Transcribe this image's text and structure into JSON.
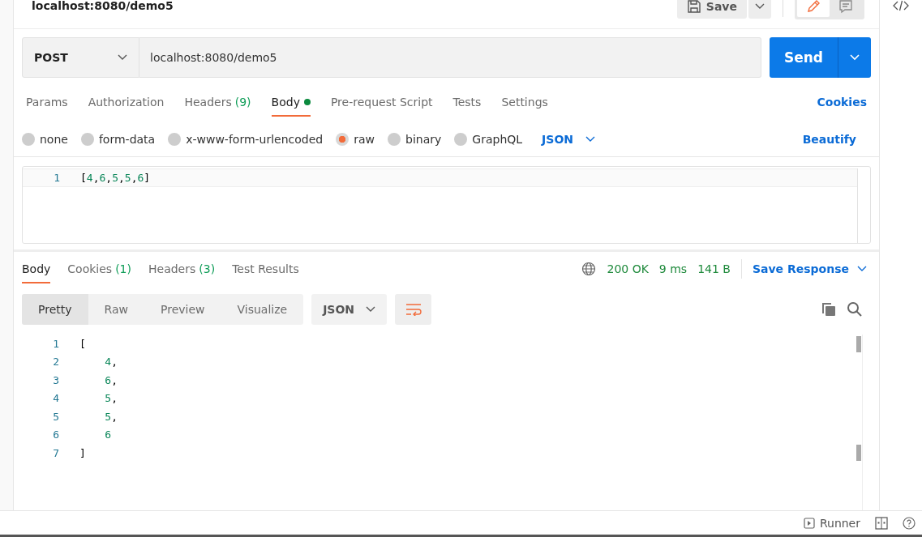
{
  "request_title": "localhost:8080/demo5",
  "header_actions": {
    "save": "Save"
  },
  "url_bar": {
    "method": "POST",
    "url": "localhost:8080/demo5",
    "send": "Send"
  },
  "request_tabs": [
    {
      "label": "Params",
      "selected": false
    },
    {
      "label": "Authorization",
      "selected": false
    },
    {
      "label": "Headers",
      "count": "(9)",
      "selected": false
    },
    {
      "label": "Body",
      "selected": true,
      "indicator": true
    },
    {
      "label": "Pre-request Script",
      "selected": false
    },
    {
      "label": "Tests",
      "selected": false
    },
    {
      "label": "Settings",
      "selected": false
    }
  ],
  "cookies_link": "Cookies",
  "body_types": [
    {
      "label": "none",
      "selected": false
    },
    {
      "label": "form-data",
      "selected": false
    },
    {
      "label": "x-www-form-urlencoded",
      "selected": false
    },
    {
      "label": "raw",
      "selected": true
    },
    {
      "label": "binary",
      "selected": false
    },
    {
      "label": "GraphQL",
      "selected": false
    }
  ],
  "raw_format": "JSON",
  "beautify": "Beautify",
  "request_body": [
    {
      "number": "1",
      "code": "[4,6,5,5,6]"
    }
  ],
  "response_tabs": [
    {
      "label": "Body",
      "selected": true
    },
    {
      "label": "Cookies",
      "count": "(1)",
      "selected": false
    },
    {
      "label": "Headers",
      "count": "(3)",
      "selected": false
    },
    {
      "label": "Test Results",
      "selected": false
    }
  ],
  "response_meta": {
    "status": "200 OK",
    "time": "9 ms",
    "size": "141 B",
    "save_response": "Save Response"
  },
  "view_modes": [
    {
      "label": "Pretty",
      "selected": true
    },
    {
      "label": "Raw",
      "selected": false
    },
    {
      "label": "Preview",
      "selected": false
    },
    {
      "label": "Visualize",
      "selected": false
    }
  ],
  "response_format": "JSON",
  "response_body": [
    {
      "number": "1",
      "code": "["
    },
    {
      "number": "2",
      "code": "    4,"
    },
    {
      "number": "3",
      "code": "    6,"
    },
    {
      "number": "4",
      "code": "    5,"
    },
    {
      "number": "5",
      "code": "    5,"
    },
    {
      "number": "6",
      "code": "    6"
    },
    {
      "number": "7",
      "code": "]"
    }
  ],
  "status_bar": {
    "runner": "Runner"
  }
}
